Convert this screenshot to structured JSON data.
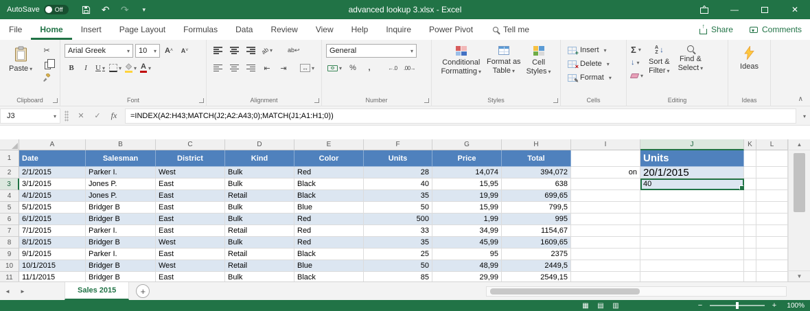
{
  "window": {
    "autosave_label": "AutoSave",
    "autosave_state": "Off",
    "title": "advanced lookup 3.xlsx  -  Excel"
  },
  "tabs": {
    "items": [
      "File",
      "Home",
      "Insert",
      "Page Layout",
      "Formulas",
      "Data",
      "Review",
      "View",
      "Help",
      "Inquire",
      "Power Pivot"
    ],
    "active": "Home",
    "tell_me": "Tell me",
    "share": "Share",
    "comments": "Comments"
  },
  "ribbon": {
    "clipboard": {
      "group": "Clipboard",
      "paste": "Paste"
    },
    "font": {
      "group": "Font",
      "name": "Arial Greek",
      "size": "10",
      "bold": "B",
      "italic": "I",
      "underline": "U",
      "font_letter": "A"
    },
    "alignment": {
      "group": "Alignment",
      "orientation": "ab",
      "wrap": "ab"
    },
    "number": {
      "group": "Number",
      "format": "General",
      "percent": "%",
      "comma": ",",
      "dec_increase": "←.0",
      "dec_decrease": ".00→"
    },
    "styles": {
      "group": "Styles",
      "conditional_1": "Conditional",
      "conditional_2": "Formatting",
      "format_table_1": "Format as",
      "format_table_2": "Table",
      "cell_styles_1": "Cell",
      "cell_styles_2": "Styles"
    },
    "cells": {
      "group": "Cells",
      "insert": "Insert",
      "delete": "Delete",
      "format": "Format"
    },
    "editing": {
      "group": "Editing",
      "autosum": "Σ",
      "fill": "↓",
      "az_a": "A",
      "az_z": "Z",
      "sort_1": "Sort &",
      "sort_2": "Filter",
      "find_1": "Find &",
      "find_2": "Select"
    },
    "ideas": {
      "group": "Ideas",
      "button": "Ideas"
    }
  },
  "formula_bar": {
    "name_box": "J3",
    "cancel": "✕",
    "enter": "✓",
    "fx": "fx",
    "formula": "=INDEX(A2:H43;MATCH(J2;A2:A43;0);MATCH(J1;A1:H1;0))"
  },
  "sheet": {
    "columns": [
      "A",
      "B",
      "C",
      "D",
      "E",
      "F",
      "G",
      "H",
      "I",
      "J",
      "K",
      "L"
    ],
    "selected_cell": "J3",
    "header_row": [
      "Date",
      "Salesman",
      "District",
      "Kind",
      "Color",
      "Units",
      "Price",
      "Total"
    ],
    "lookup_header": "Units",
    "rows": [
      {
        "n": "2",
        "cells": [
          "2/1/2015",
          "Parker I.",
          "West",
          "Bulk",
          "Red",
          "28",
          "14,074",
          "394,072"
        ],
        "i": "on",
        "j": "20/1/2015"
      },
      {
        "n": "3",
        "cells": [
          "3/1/2015",
          "Jones P.",
          "East",
          "Bulk",
          "Black",
          "40",
          "15,95",
          "638"
        ],
        "i": "",
        "j": "40"
      },
      {
        "n": "4",
        "cells": [
          "4/1/2015",
          "Jones P.",
          "East",
          "Retail",
          "Black",
          "35",
          "19,99",
          "699,65"
        ]
      },
      {
        "n": "5",
        "cells": [
          "5/1/2015",
          "Bridger B",
          "East",
          "Bulk",
          "Blue",
          "50",
          "15,99",
          "799,5"
        ]
      },
      {
        "n": "6",
        "cells": [
          "6/1/2015",
          "Bridger B",
          "East",
          "Bulk",
          "Red",
          "500",
          "1,99",
          "995"
        ]
      },
      {
        "n": "7",
        "cells": [
          "7/1/2015",
          "Parker I.",
          "East",
          "Retail",
          "Red",
          "33",
          "34,99",
          "1154,67"
        ]
      },
      {
        "n": "8",
        "cells": [
          "8/1/2015",
          "Bridger B",
          "West",
          "Bulk",
          "Red",
          "35",
          "45,99",
          "1609,65"
        ]
      },
      {
        "n": "9",
        "cells": [
          "9/1/2015",
          "Parker I.",
          "East",
          "Retail",
          "Black",
          "25",
          "95",
          "2375"
        ]
      },
      {
        "n": "10",
        "cells": [
          "10/1/2015",
          "Bridger B",
          "West",
          "Retail",
          "Blue",
          "50",
          "48,99",
          "2449,5"
        ]
      },
      {
        "n": "11",
        "cells": [
          "11/1/2015",
          "Bridger B",
          "East",
          "Bulk",
          "Black",
          "85",
          "29,99",
          "2549,15"
        ]
      }
    ]
  },
  "sheet_bar": {
    "tab": "Sales 2015",
    "add": "+"
  },
  "status_bar": {
    "zoom": "100%",
    "zoom_out": "−",
    "zoom_in": "+"
  },
  "icons": {
    "undo": "↶",
    "redo": "↷",
    "scissors": "✂",
    "caret_up_small": "˄",
    "caret_down_small": "˅",
    "minimize": "—",
    "close": "✕",
    "collapse_ribbon": "∧",
    "outdent": "⇤",
    "indent": "⇥",
    "merge": "↔",
    "wrap_return": "↩",
    "arrow_down": "↓",
    "scroll_up": "▲",
    "scroll_down": "▼",
    "tab_prev": "◄",
    "tab_next": "►",
    "view_normal": "▦",
    "view_page_layout": "▤",
    "view_page_break": "▥",
    "pencil": "✎",
    "plus_badge": "+",
    "x_badge": "×"
  },
  "colors": {
    "excel_green": "#217346",
    "table_header_blue": "#4F81BD",
    "table_band_blue": "#DCE6F1",
    "fill_yellow": "#FFD33C",
    "font_color_red": "#C00000"
  }
}
